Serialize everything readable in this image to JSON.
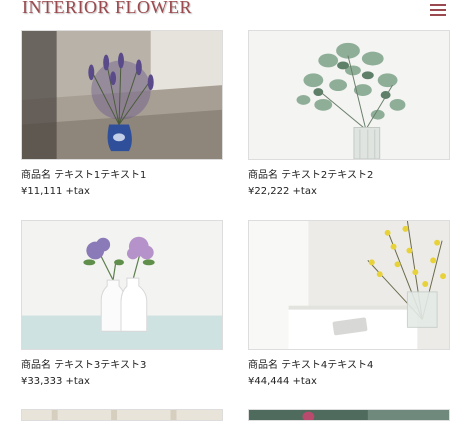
{
  "header": {
    "logo": "INTERIOR FLOWER",
    "menu_icon": "hamburger-menu-icon"
  },
  "products": [
    {
      "name": "商品名 テキスト1テキスト1",
      "price": "¥11,111 +tax",
      "image": "lavender-vase-photo"
    },
    {
      "name": "商品名 テキスト2テキスト2",
      "price": "¥22,222 +tax",
      "image": "eucalyptus-vase-photo"
    },
    {
      "name": "商品名 テキスト3テキスト3",
      "price": "¥33,333 +tax",
      "image": "hydrangea-bottles-photo"
    },
    {
      "name": "商品名 テキスト4テキスト4",
      "price": "¥44,444 +tax",
      "image": "forsythia-vase-photo"
    }
  ],
  "colors": {
    "brand": "#9a4a4e"
  }
}
